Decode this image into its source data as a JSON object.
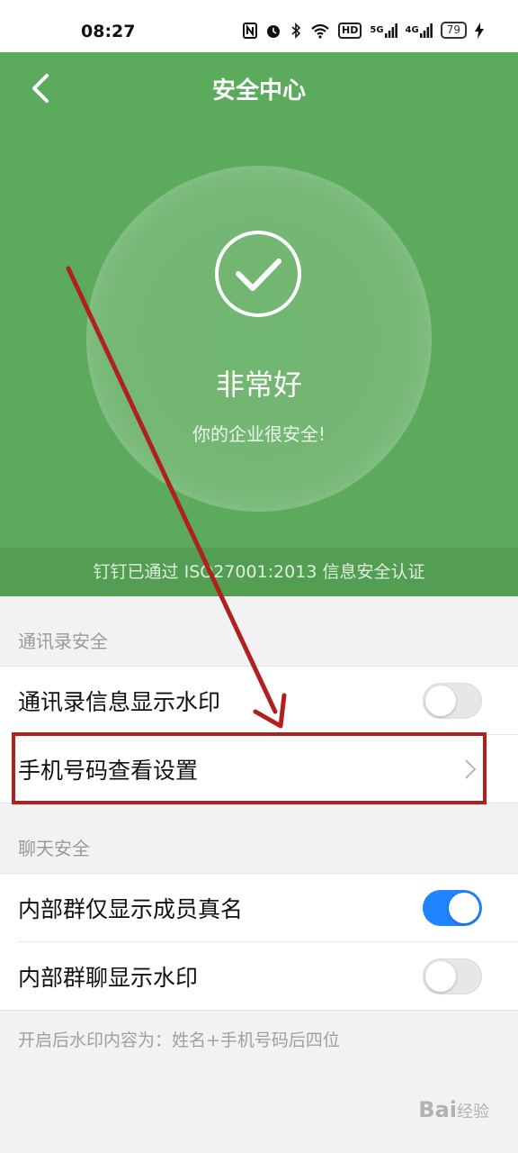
{
  "status_bar": {
    "time": "08:27",
    "icons": [
      "nfc-icon",
      "alarm-icon",
      "bluetooth-icon",
      "wifi-icon",
      "hd-icon",
      "5g-signal-icon",
      "4g-signal-icon",
      "battery-icon",
      "charging-icon"
    ],
    "hd_label": "HD",
    "net_5g": "5G",
    "net_4g": "4G",
    "battery": "79"
  },
  "header": {
    "title": "安全中心"
  },
  "security_status": {
    "label": "非常好",
    "description": "你的企业很安全!"
  },
  "certification": {
    "text": "钉钉已通过 ISO27001:2013 信息安全认证"
  },
  "sections": [
    {
      "header": "通讯录安全",
      "rows": [
        {
          "label": "通讯录信息显示水印",
          "type": "toggle",
          "value": false
        },
        {
          "label": "手机号码查看设置",
          "type": "link"
        }
      ]
    },
    {
      "header": "聊天安全",
      "rows": [
        {
          "label": "内部群仅显示成员真名",
          "type": "toggle",
          "value": true
        },
        {
          "label": "内部群聊显示水印",
          "type": "toggle",
          "value": false
        }
      ]
    }
  ],
  "footnote": "开启后水印内容为：姓名+手机号码后四位",
  "watermark": {
    "brand": "Bai",
    "suffix": "经验"
  },
  "colors": {
    "header_green": "#5cab5c",
    "toggle_on": "#1f84ff",
    "annotation_red": "#b0201c"
  }
}
